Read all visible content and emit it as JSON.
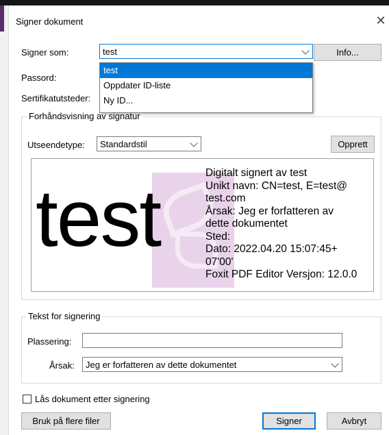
{
  "dialog": {
    "title": "Signer dokument",
    "close_glyph": "✕"
  },
  "sign_as": {
    "label": "Signer som:",
    "value": "test",
    "info_button": "Info...",
    "options": [
      "test",
      "Oppdater ID-liste",
      "Ny ID..."
    ],
    "selected_index": 0
  },
  "password": {
    "label": "Passord:"
  },
  "cert_issuers": {
    "label": "Sertifikatutsteder:"
  },
  "preview_group": {
    "legend": "Forhåndsvisning av signatur",
    "appearance_label": "Utseendetype:",
    "appearance_value": "Standardstil",
    "create_button": "Opprett",
    "big_name": "test",
    "signature_lines": [
      "Digitalt signert av test",
      "Unikt navn: CN=test, E=test@",
      "test.com",
      "Årsak: Jeg er forfatteren av",
      "dette dokumentet",
      "Sted:",
      "Dato: 2022.04.20 15:07:45+",
      "07'00'",
      "Foxit PDF Editor Versjon: 12.0.0"
    ]
  },
  "signing_text_group": {
    "legend": "Tekst for signering",
    "location_label": "Plassering:",
    "location_value": "",
    "reason_label": "Årsak:",
    "reason_value": "Jeg er forfatteren av dette dokumentet"
  },
  "lock_checkbox": {
    "label": "Lås dokument etter signering",
    "checked": false
  },
  "buttons": {
    "apply_multiple": "Bruk på flere filer",
    "sign": "Signer",
    "cancel": "Avbryt"
  },
  "colors": {
    "accent": "#0078d7",
    "selection_bg": "#0078d7",
    "watermark": "#e9d3ea"
  }
}
